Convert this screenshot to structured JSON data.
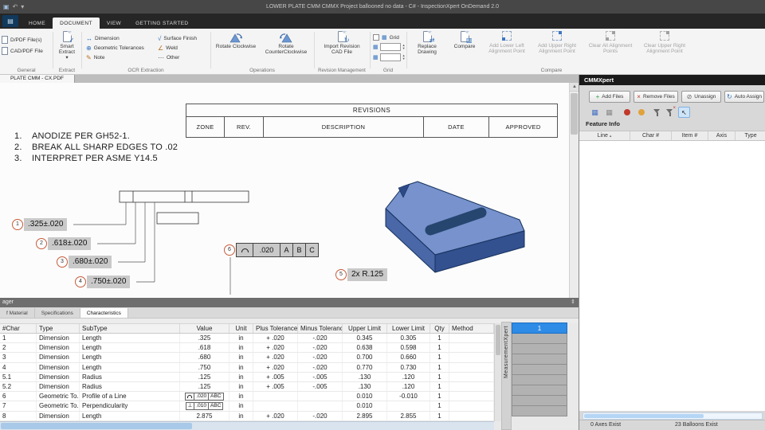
{
  "titlebar": {
    "title": "LOWER PLATE CMM CMMX Project ballooned no data  -  C#  -  InspectionXpert OnDemand 2.0"
  },
  "menu": {
    "tabs": [
      "HOME",
      "DOCUMENT",
      "VIEW",
      "GETTING STARTED"
    ]
  },
  "ribbon": {
    "general": {
      "btn1": "D/PDF File(s)",
      "btn2": "CAD/PDF File",
      "label": "General"
    },
    "extract": {
      "button": "Smart Extract",
      "caret": "▾",
      "label": "Extract"
    },
    "ocr": {
      "items": [
        "Dimension",
        "Geometric Tolerances",
        "Note",
        "Surface Finish",
        "Weld",
        "Other"
      ],
      "label": "OCR Extraction"
    },
    "operations": {
      "btn1": "Rotate Clockwise",
      "btn2": "Rotate CounterClockwise",
      "label": "Operations"
    },
    "revision": {
      "btn1": "Import Revision CAD File",
      "label": "Revision Management"
    },
    "grid": {
      "checkbox": "Grid",
      "label": "Grid"
    },
    "compare": {
      "btn1": "Replace Drawing",
      "btn2": "Compare",
      "btn3": "Add Lower Left Alignment Point",
      "btn4": "Add Upper Right Alignment Point",
      "btn5": "Clear All Alignment Points",
      "btn6": "Clear Upper Right Alignment Point",
      "label": "Compare"
    }
  },
  "doc_tab": {
    "label": "PLATE CMM - CX.PDF"
  },
  "drawing": {
    "notes": [
      {
        "num": "1.",
        "text": "ANODIZE PER GH52-1."
      },
      {
        "num": "2.",
        "text": "BREAK ALL SHARP EDGES TO .02"
      },
      {
        "num": "3.",
        "text": "INTERPRET PER ASME Y14.5"
      }
    ],
    "revisions": {
      "title": "REVISIONS",
      "cols": [
        "ZONE",
        "REV.",
        "DESCRIPTION",
        "DATE",
        "APPROVED"
      ]
    },
    "balloons": [
      {
        "num": "1",
        "label": ".325±.020"
      },
      {
        "num": "2",
        "label": ".618±.020"
      },
      {
        "num": "3",
        "label": ".680±.020"
      },
      {
        "num": "4",
        "label": ".750±.020"
      },
      {
        "num": "5",
        "label": "2x R.125"
      },
      {
        "num": "6",
        "fcf": {
          "value": ".020",
          "d1": "A",
          "d2": "B",
          "d3": "C"
        }
      }
    ]
  },
  "bottom_panel": {
    "header": "ager",
    "tabs": [
      "f Material",
      "Specifications",
      "Characteristics"
    ],
    "columns": [
      "#Char",
      "Type",
      "SubType",
      "Value",
      "Unit",
      "Plus Tolerance",
      "Minus Tolerance",
      "Upper Limit",
      "Lower Limit",
      "Qty",
      "Method"
    ],
    "rows": [
      {
        "char": "1",
        "type": "Dimension",
        "subtype": "Length",
        "value": ".325",
        "unit": "in",
        "plus": "+ .020",
        "minus": "-.020",
        "upper": "0.345",
        "lower": "0.305",
        "qty": "1",
        "method": ""
      },
      {
        "char": "2",
        "type": "Dimension",
        "subtype": "Length",
        "value": ".618",
        "unit": "in",
        "plus": "+ .020",
        "minus": "-.020",
        "upper": "0.638",
        "lower": "0.598",
        "qty": "1",
        "method": ""
      },
      {
        "char": "3",
        "type": "Dimension",
        "subtype": "Length",
        "value": ".680",
        "unit": "in",
        "plus": "+ .020",
        "minus": "-.020",
        "upper": "0.700",
        "lower": "0.660",
        "qty": "1",
        "method": ""
      },
      {
        "char": "4",
        "type": "Dimension",
        "subtype": "Length",
        "value": ".750",
        "unit": "in",
        "plus": "+ .020",
        "minus": "-.020",
        "upper": "0.770",
        "lower": "0.730",
        "qty": "1",
        "method": ""
      },
      {
        "char": "5.1",
        "type": "Dimension",
        "subtype": "Radius",
        "value": ".125",
        "unit": "in",
        "plus": "+ .005",
        "minus": "-.005",
        "upper": ".130",
        "lower": ".120",
        "qty": "1",
        "method": ""
      },
      {
        "char": "5.2",
        "type": "Dimension",
        "subtype": "Radius",
        "value": ".125",
        "unit": "in",
        "plus": "+ .005",
        "minus": "-.005",
        "upper": ".130",
        "lower": ".120",
        "qty": "1",
        "method": ""
      },
      {
        "char": "6",
        "type": "Geometric To...",
        "subtype": "Profile of a Line",
        "fcf": {
          "sym": "arc",
          "value": ".020",
          "datums": "ABC"
        },
        "unit": "in",
        "plus": "",
        "minus": "",
        "upper": "0.010",
        "lower": "-0.010",
        "qty": "1",
        "method": ""
      },
      {
        "char": "7",
        "type": "Geometric To...",
        "subtype": "Perpendicularity",
        "fcf": {
          "sym": "perp",
          "value": ".010",
          "datums": "ABC"
        },
        "unit": "in",
        "plus": "",
        "minus": "",
        "upper": "0.010",
        "lower": "",
        "qty": "1",
        "method": ""
      },
      {
        "char": "8",
        "type": "Dimension",
        "subtype": "Length",
        "value": "2.875",
        "unit": "in",
        "plus": "+ .020",
        "minus": "-.020",
        "upper": "2.895",
        "lower": "2.855",
        "qty": "1",
        "method": ""
      }
    ],
    "matrix": {
      "header": "1",
      "cell_count": 8
    },
    "side_tab": "MeasurementXpert"
  },
  "right_panel": {
    "title": "CMMXpert",
    "buttons": [
      "Add Files",
      "Remove Files",
      "Unassign",
      "Auto Assign"
    ],
    "section": "Feature Info",
    "columns": [
      "Line",
      "Char #",
      "Item #",
      "Axis",
      "Type"
    ],
    "sort_glyph": "▴",
    "status_left": "0 Axes Exist",
    "status_right": "23 Balloons Exist"
  }
}
